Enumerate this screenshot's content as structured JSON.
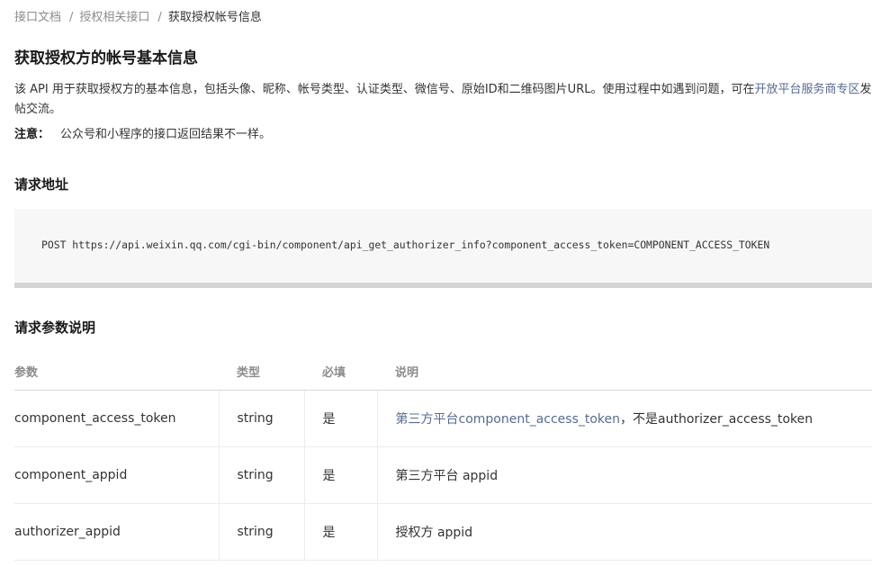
{
  "breadcrumb": {
    "item1": "接口文档",
    "item2": "授权相关接口",
    "current": "获取授权帐号信息",
    "separator": "/"
  },
  "page": {
    "title": "获取授权方的帐号基本信息",
    "intro_text": "该 API 用于获取授权方的基本信息，包括头像、昵称、帐号类型、认证类型、微信号、原始ID和二维码图片URL。使用过程中如遇到问题，可在",
    "intro_link": "开放平台服务商专区",
    "intro_tail": "发帖交流。",
    "note_label": "注意：",
    "note_text": "公众号和小程序的接口返回结果不一样。"
  },
  "request_url": {
    "section_title": "请求地址",
    "code": "POST https://api.weixin.qq.com/cgi-bin/component/api_get_authorizer_info?component_access_token=COMPONENT_ACCESS_TOKEN"
  },
  "params": {
    "section_title": "请求参数说明",
    "headers": [
      "参数",
      "类型",
      "必填",
      "说明"
    ],
    "rows": [
      {
        "name": "component_access_token",
        "type": "string",
        "required": "是",
        "desc_link": "第三方平台component_access_token",
        "desc_text": "，不是authorizer_access_token"
      },
      {
        "name": "component_appid",
        "type": "string",
        "required": "是",
        "desc_link": "",
        "desc_text": "第三方平台 appid"
      },
      {
        "name": "authorizer_appid",
        "type": "string",
        "required": "是",
        "desc_link": "",
        "desc_text": "授权方 appid"
      }
    ]
  },
  "colors": {
    "link": "#576b95",
    "muted": "#8c8c8c",
    "code_bg": "#f7f7f7",
    "code_border": "#d4d4d4"
  }
}
